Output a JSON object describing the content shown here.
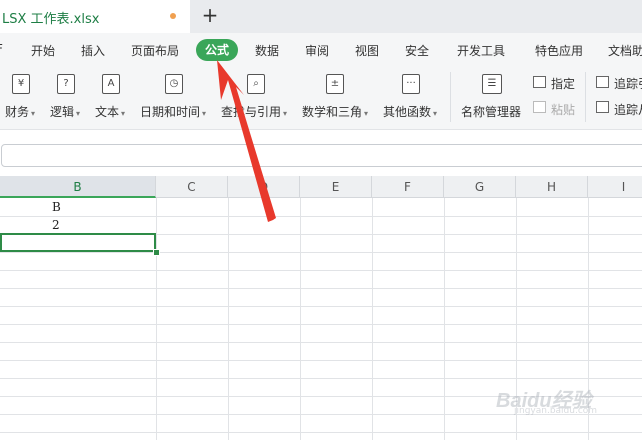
{
  "tabbar": {
    "file_tab_label": "LSX 工作表.xlsx",
    "new_tab": "+"
  },
  "menu": {
    "partial_left": "F",
    "tabs": [
      "开始",
      "插入",
      "页面布局",
      "公式",
      "数据",
      "审阅",
      "视图",
      "安全",
      "开发工具",
      "特色应用",
      "文档助"
    ],
    "active": "公式"
  },
  "ribbon": {
    "groups": [
      {
        "label": "财务",
        "icon": "¥"
      },
      {
        "label": "逻辑",
        "icon": "?"
      },
      {
        "label": "文本",
        "icon": "A"
      },
      {
        "label": "日期和时间",
        "icon": "◷"
      },
      {
        "label": "查找与引用",
        "icon": "⌕"
      },
      {
        "label": "数学和三角",
        "icon": "±"
      },
      {
        "label": "其他函数",
        "icon": "···"
      }
    ],
    "name_manager": "名称管理器",
    "specify": "指定",
    "paste": "粘贴",
    "trace_precedents": "追踪引",
    "trace_dependents": "追踪从"
  },
  "columns": [
    "B",
    "C",
    "D",
    "E",
    "F",
    "G",
    "H",
    "I"
  ],
  "cells": {
    "row1": "B",
    "row2": "2"
  },
  "watermark": {
    "brand": "Baidu经验",
    "sub": "jingyan.baidu.com"
  }
}
